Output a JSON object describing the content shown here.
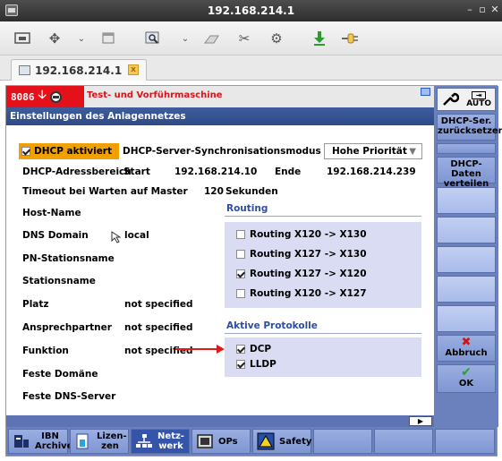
{
  "window": {
    "title": "192.168.214.1"
  },
  "tab": {
    "label": "192.168.214.1",
    "close_symbol": "x"
  },
  "alarm": {
    "code": "8086",
    "text": "Test- und Vorführmaschine"
  },
  "header": {
    "title": "Einstellungen des Anlagennetzes"
  },
  "settings": {
    "dhcp_enabled_label": "DHCP aktiviert",
    "dhcp_sync_label": "DHCP-Server-Synchronisationsmodus",
    "dhcp_sync_value": "Hohe Priorität",
    "dhcp_range_label": "DHCP-Adressbereich",
    "start_label": "Start",
    "start_value": "192.168.214.10",
    "end_label": "Ende",
    "end_value": "192.168.214.239",
    "timeout_label": "Timeout bei Warten auf Master",
    "timeout_value": "120",
    "timeout_unit": "Sekunden",
    "host_name_label": "Host-Name",
    "dns_domain_label": "DNS Domain",
    "dns_domain_value": "local",
    "pn_station_label": "PN-Stationsname",
    "station_label": "Stationsname",
    "place_label": "Platz",
    "place_value": "not specified",
    "contact_label": "Ansprechpartner",
    "contact_value": "not specified",
    "function_label": "Funktion",
    "function_value": "not specified",
    "fixed_domain_label": "Feste Domäne",
    "fixed_dns_label": "Feste DNS-Server"
  },
  "routing": {
    "heading": "Routing",
    "items": [
      {
        "label": "Routing X120 -> X130",
        "checked": false
      },
      {
        "label": "Routing X127 -> X130",
        "checked": false
      },
      {
        "label": "Routing X127 -> X120",
        "checked": true
      },
      {
        "label": "Routing X120 -> X127",
        "checked": false
      }
    ]
  },
  "protocols": {
    "heading": "Aktive Protokolle",
    "items": [
      {
        "label": "DCP",
        "checked": true
      },
      {
        "label": "LLDP",
        "checked": true
      }
    ]
  },
  "vertical_softkeys": {
    "auto_label": "AUTO",
    "dhcp_reset": "DHCP-Ser. zurücksetzen",
    "dhcp_distribute": "DHCP-Daten verteilen",
    "cancel": "Abbruch",
    "ok": "OK"
  },
  "horizontal_softkeys": {
    "ibn_archive": "IBN Archive",
    "licenses": "Lizen- zen",
    "network": "Netz- werk",
    "ops": "OPs",
    "safety": "Safety"
  },
  "colors": {
    "alarm_red": "#e4111a",
    "header_blue": "#2e4a88",
    "dhcp_highlight": "#f0a000",
    "softkey_blue": "#8fa3db",
    "panel_lavender": "#d9dcf2"
  }
}
